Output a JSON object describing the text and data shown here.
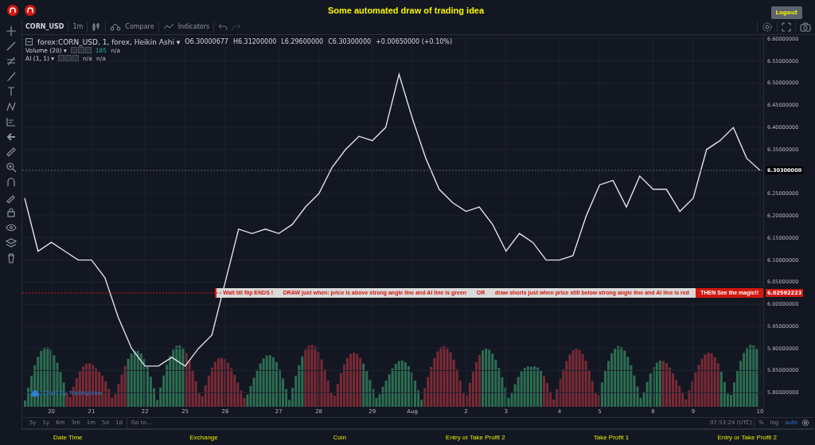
{
  "header": {
    "title": "Some automated draw of trading idea",
    "logout": "Logout"
  },
  "toolbar": {
    "symbol": "CORN_USD",
    "interval": "1m",
    "compare": "Compare",
    "indicators": "Indicators"
  },
  "legend": {
    "series": "forex:CORN_USD, 1, forex, Heikin Ashi ▾",
    "ohlc": [
      {
        "label": "O",
        "value": "6.30000677"
      },
      {
        "label": "H",
        "value": "6.31200000"
      },
      {
        "label": "L",
        "value": "6.29600000"
      },
      {
        "label": "C",
        "value": "6.30300000"
      }
    ],
    "change": "+0.00650000 (+0.10%)",
    "studies": [
      {
        "name": "Volume (20) ▾",
        "values": [
          {
            "text": "185",
            "kind": "up"
          },
          {
            "text": "n/a",
            "kind": "plain"
          }
        ]
      },
      {
        "name": "AI (1, 1) ▾",
        "values": [
          {
            "text": "n/a",
            "kind": "plain"
          },
          {
            "text": "n/a",
            "kind": "plain"
          }
        ]
      }
    ]
  },
  "chart_data": {
    "type": "line",
    "ylim": [
      5.768,
      6.609
    ],
    "grid": true,
    "categories": [
      null,
      null,
      "20",
      null,
      null,
      "21",
      null,
      null,
      null,
      "22",
      null,
      null,
      "25",
      null,
      null,
      "26",
      null,
      null,
      null,
      "27",
      null,
      null,
      "28",
      null,
      null,
      null,
      "29",
      null,
      null,
      "Aug",
      null,
      null,
      null,
      "2",
      null,
      null,
      "3",
      null,
      null,
      null,
      "4",
      null,
      null,
      "5",
      null,
      null,
      null,
      "8",
      null,
      null,
      "9",
      null,
      null,
      null,
      null,
      "10"
    ],
    "yticks": [
      {
        "value": 6.6,
        "label": "6.60000000"
      },
      {
        "value": 6.55,
        "label": "6.55000000"
      },
      {
        "value": 6.5,
        "label": "6.50000000"
      },
      {
        "value": 6.45,
        "label": "6.45000000"
      },
      {
        "value": 6.4,
        "label": "6.40000000"
      },
      {
        "value": 6.35,
        "label": "6.35000000"
      },
      {
        "value": 6.25,
        "label": "6.25000000"
      },
      {
        "value": 6.2,
        "label": "6.20000000"
      },
      {
        "value": 6.15,
        "label": "6.15000000"
      },
      {
        "value": 6.1,
        "label": "6.10000000"
      },
      {
        "value": 6.05,
        "label": "6.05000000"
      },
      {
        "value": 6.0,
        "label": "6.00000000"
      },
      {
        "value": 5.95,
        "label": "5.95000000"
      },
      {
        "value": 5.9,
        "label": "5.90000000"
      },
      {
        "value": 5.85,
        "label": "5.85000000"
      },
      {
        "value": 5.8,
        "label": "5.80000000"
      }
    ],
    "series": [
      {
        "color": "#e0e3eb",
        "values": [
          6.24,
          6.12,
          6.14,
          6.12,
          6.1,
          6.1,
          6.06,
          5.97,
          5.9,
          5.86,
          5.86,
          5.88,
          5.86,
          5.9,
          5.93,
          6.05,
          6.17,
          6.16,
          6.17,
          6.16,
          6.18,
          6.22,
          6.25,
          6.31,
          6.35,
          6.38,
          6.37,
          6.4,
          6.52,
          6.42,
          6.33,
          6.26,
          6.23,
          6.21,
          6.22,
          6.18,
          6.12,
          6.16,
          6.14,
          6.1,
          6.1,
          6.11,
          6.2,
          6.27,
          6.28,
          6.22,
          6.29,
          6.26,
          6.26,
          6.21,
          6.24,
          6.35,
          6.37,
          6.4,
          6.33,
          6.303
        ]
      }
    ]
  },
  "price_labels": [
    {
      "kind": "last",
      "text": "6.30300000"
    },
    {
      "kind": "alert",
      "text": "6.02592223"
    }
  ],
  "signal_banner": {
    "message": [
      "Wait till flip ENDS  !",
      "DRAW just when:  price is above strong angle line and AI line is green",
      "OR",
      "draw shorts just when price still below strong angle line and AI line is red"
    ],
    "action": "THEN See the magic!!"
  },
  "branding": "Chart by TradingView",
  "ranges": [
    {
      "label": "5y",
      "selected": false
    },
    {
      "label": "1y",
      "selected": false
    },
    {
      "label": "6m",
      "selected": false
    },
    {
      "label": "3m",
      "selected": false
    },
    {
      "label": "1m",
      "selected": false
    },
    {
      "label": "5d",
      "selected": false
    },
    {
      "label": "1d",
      "selected": false
    }
  ],
  "goto": "Go to...",
  "clock": "07:53:24 (UTC)",
  "scale_options": [
    {
      "label": "%",
      "selected": false
    },
    {
      "label": "log",
      "selected": false
    },
    {
      "label": "auto",
      "selected": true
    }
  ],
  "footer": [
    "Date Time",
    "Exchange",
    "Coin",
    "Entry or Take Profit 2",
    "Take Profit 1",
    "Entry or Take Profit 2"
  ]
}
